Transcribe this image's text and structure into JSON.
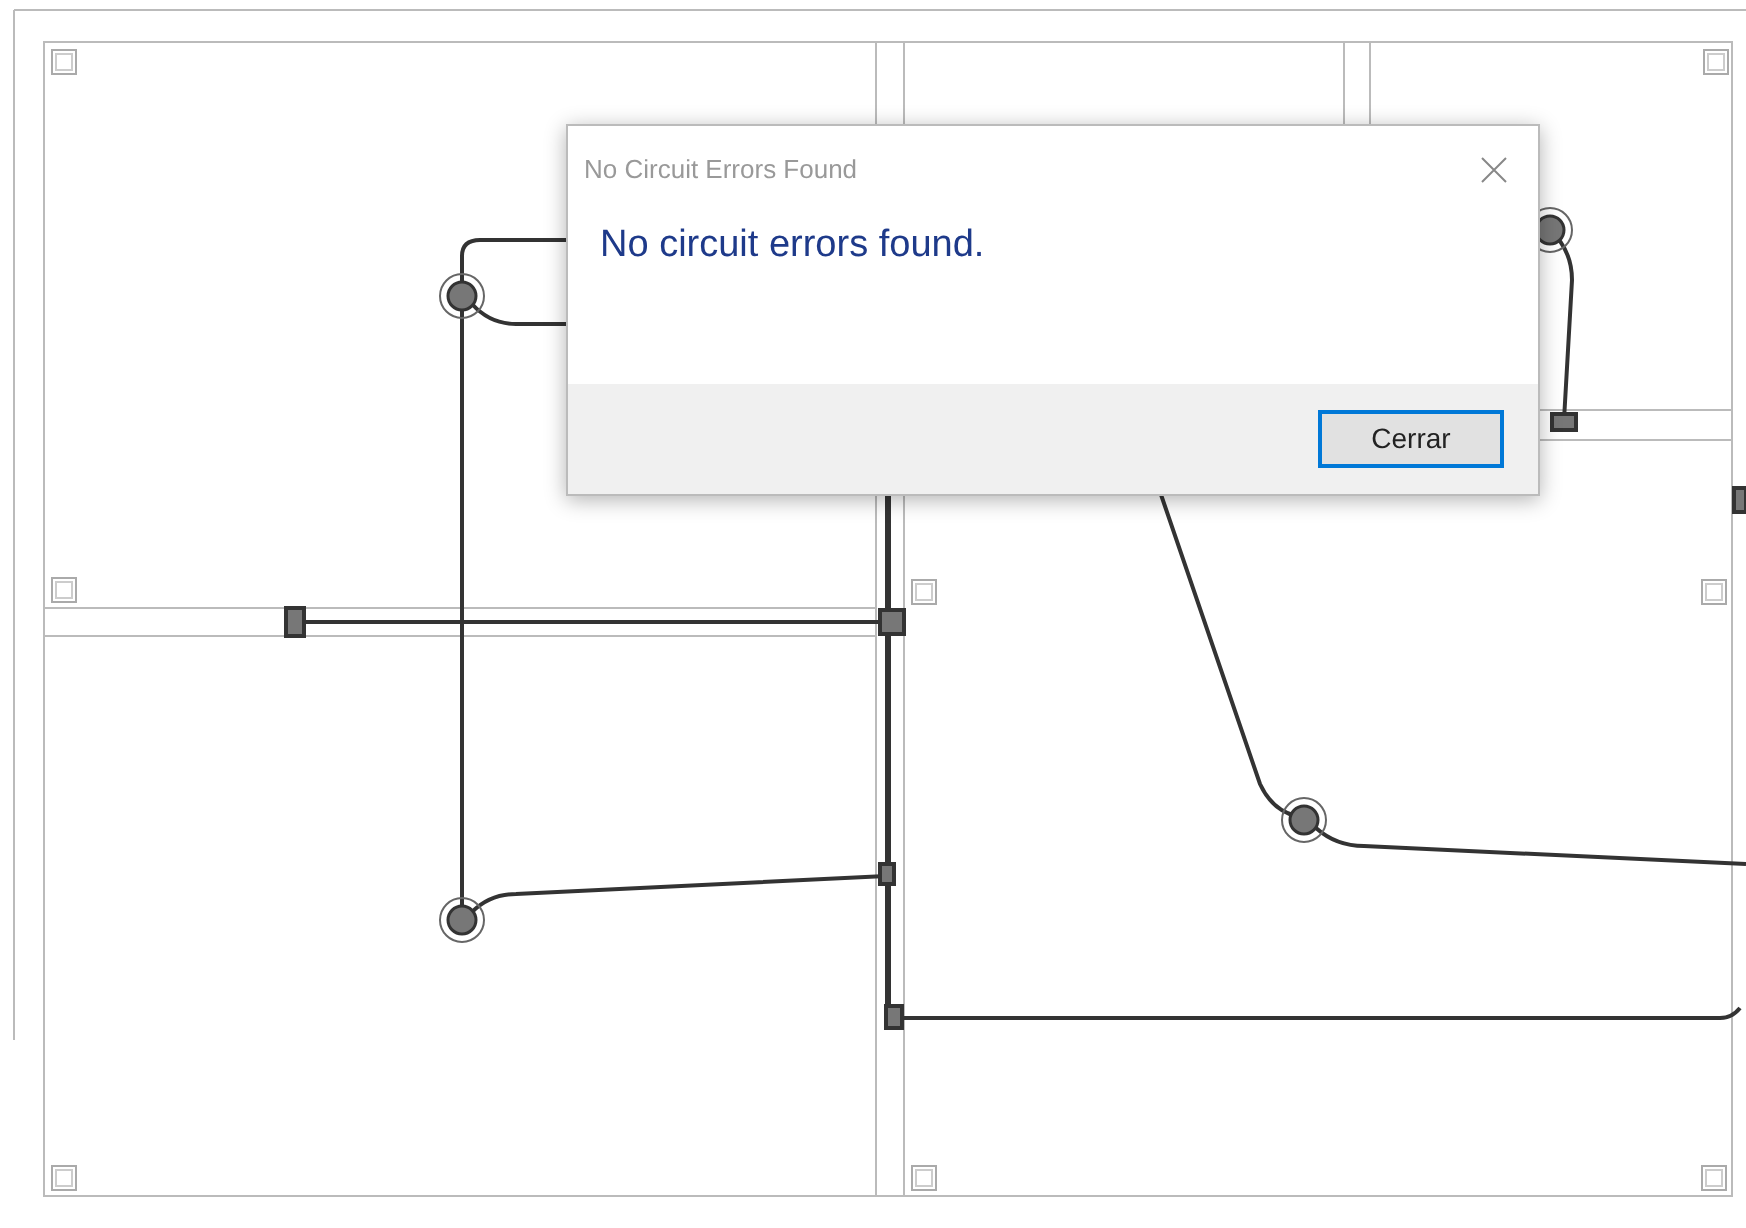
{
  "dialog": {
    "title": "No Circuit Errors Found",
    "message": "No circuit errors found.",
    "buttons": [
      {
        "label": "Cerrar",
        "focused": true
      }
    ]
  }
}
